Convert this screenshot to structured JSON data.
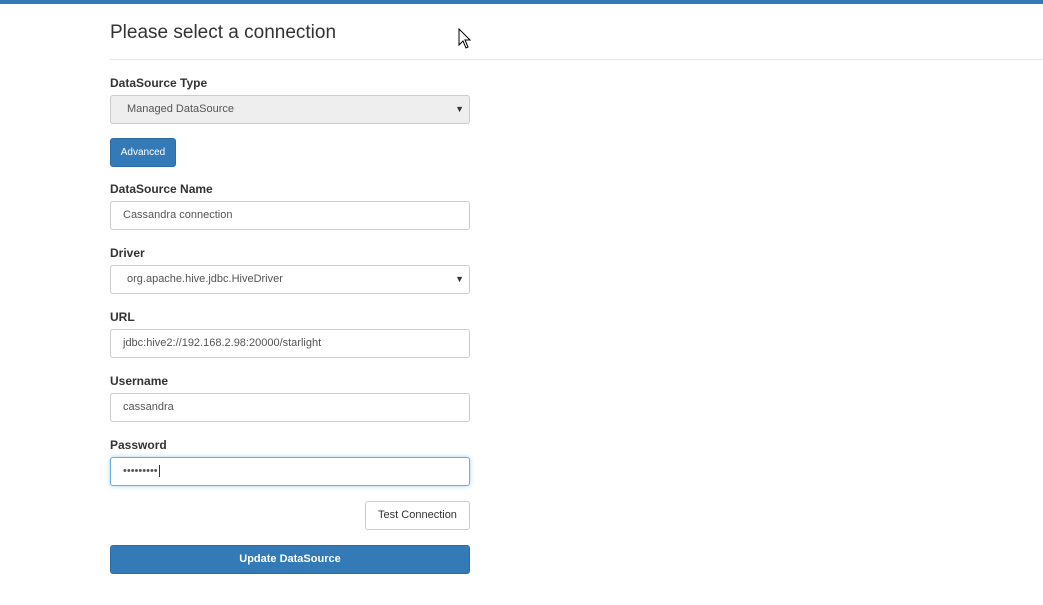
{
  "page": {
    "title": "Please select a connection"
  },
  "form": {
    "datasource_type": {
      "label": "DataSource Type",
      "value": "Managed DataSource"
    },
    "advanced_button": "Advanced",
    "datasource_name": {
      "label": "DataSource Name",
      "value": "Cassandra connection"
    },
    "driver": {
      "label": "Driver",
      "value": "org.apache.hive.jdbc.HiveDriver"
    },
    "url": {
      "label": "URL",
      "value": "jdbc:hive2://192.168.2.98:20000/starlight"
    },
    "username": {
      "label": "Username",
      "value": "cassandra"
    },
    "password": {
      "label": "Password",
      "masked_value": "•••••••••"
    },
    "test_connection_button": "Test Connection",
    "update_button": "Update DataSource"
  },
  "icons": {
    "select_caret": "▼",
    "cursor": "mouse-pointer-icon"
  },
  "colors": {
    "primary": "#337ab7",
    "focus_border": "#66afe9",
    "disabled_bg": "#eeeeee"
  }
}
